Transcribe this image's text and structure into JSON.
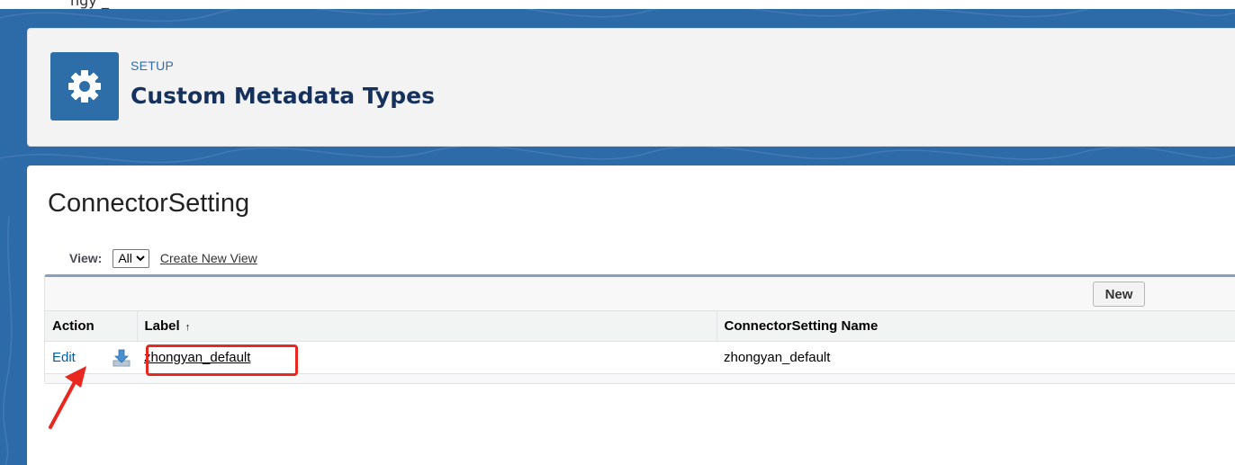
{
  "top_strip_text": "ngy _",
  "header": {
    "breadcrumb": "SETUP",
    "title": "Custom Metadata Types",
    "icon": "gear-icon"
  },
  "object": {
    "title": "ConnectorSetting"
  },
  "view": {
    "label": "View:",
    "selected": "All",
    "create_link": "Create New View"
  },
  "list": {
    "new_button": "New",
    "columns": [
      "Action",
      "Label",
      "ConnectorSetting Name"
    ],
    "sort_indicator": "↑",
    "rows": [
      {
        "action": "Edit",
        "label": "zhongyan_default",
        "name": "zhongyan_default"
      }
    ]
  },
  "colors": {
    "brand_blue": "#2e6ea8",
    "title_navy": "#16325c",
    "link_blue": "#015ba7",
    "annotation_red": "#e8271f"
  }
}
